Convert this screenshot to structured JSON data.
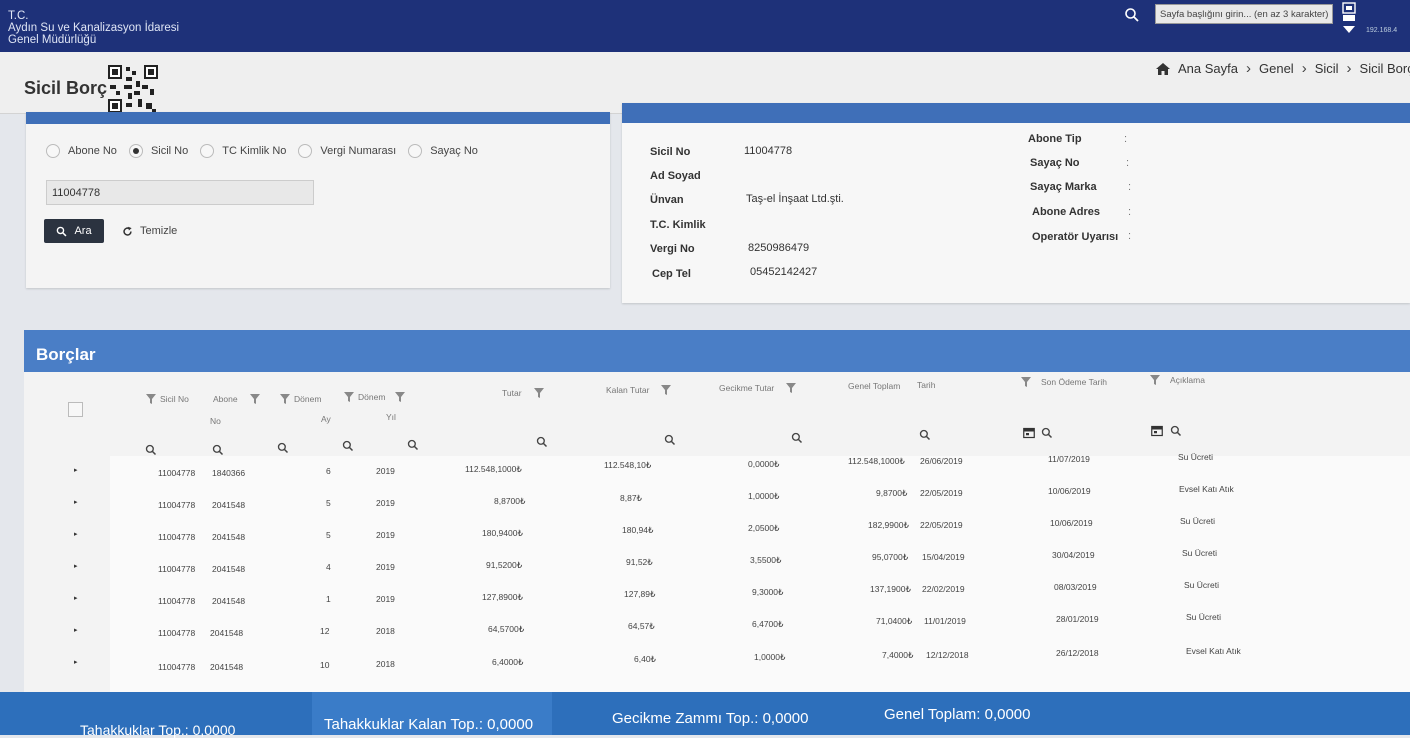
{
  "topbar": {
    "org_line1": "T.C.",
    "org_line2": "Aydın Su ve Kanalizasyon İdaresi",
    "org_line3": "Genel Müdürlüğü",
    "search_placeholder": "Sayfa başlığını girin... (en az 3 karakter)",
    "ip": "192.168.4"
  },
  "page": {
    "title": "Sicil Borç",
    "breadcrumb": [
      "Ana Sayfa",
      "Genel",
      "Sicil",
      "Sicil Borç"
    ]
  },
  "filter": {
    "options": [
      "Abone No",
      "Sicil No",
      "TC Kimlik No",
      "Vergi Numarası",
      "Sayaç No"
    ],
    "selected": "Sicil No",
    "value": "11004778",
    "search_button": "Ara",
    "clear_button": "Temizle"
  },
  "info": {
    "left": [
      {
        "label": "Sicil No",
        "value": "11004778"
      },
      {
        "label": "Ad Soyad",
        "value": ""
      },
      {
        "label": "Ünvan",
        "value": "Taş-el İnşaat Ltd.şti."
      },
      {
        "label": "T.C. Kimlik",
        "value": ""
      },
      {
        "label": "Vergi No",
        "value": "8250986479"
      },
      {
        "label": "Cep Tel",
        "value": "05452142427"
      }
    ],
    "right": [
      {
        "label": "Abone Tip",
        "value": ""
      },
      {
        "label": "Sayaç No",
        "value": ""
      },
      {
        "label": "Sayaç Marka",
        "value": ""
      },
      {
        "label": "Abone Adres",
        "value": ""
      },
      {
        "label": "Operatör Uyarısı",
        "value": ""
      }
    ]
  },
  "borclar": {
    "title": "Borçlar",
    "columns": {
      "sicil_no": "Sicil No",
      "abone_no_1": "Abone",
      "abone_no_2": "No",
      "donem_ay_1": "Dönem",
      "donem_ay_2": "Ay",
      "donem_yil_1": "Dönem",
      "donem_yil_2": "Yıl",
      "tutar": "Tutar",
      "kalan_tutar": "Kalan Tutar",
      "gecikme_tutar": "Gecikme Tutar",
      "genel_toplam": "Genel Toplam",
      "tarih": "Tarih",
      "son_odeme": "Son Ödeme Tarih",
      "aciklama": "Açıklama"
    },
    "rows": [
      {
        "sicil": "11004778",
        "abone": "1840366",
        "ay": "6",
        "yil": "2019",
        "tutar": "112.548,1000₺",
        "kalan": "112.548,10₺",
        "gecikme": "0,0000₺",
        "genel": "112.548,1000₺",
        "tarih": "26/06/2019",
        "son_odeme": "11/07/2019",
        "aciklama": "Su Ücreti"
      },
      {
        "sicil": "11004778",
        "abone": "2041548",
        "ay": "5",
        "yil": "2019",
        "tutar": "8,8700₺",
        "kalan": "8,87₺",
        "gecikme": "1,0000₺",
        "genel": "9,8700₺",
        "tarih": "22/05/2019",
        "son_odeme": "10/06/2019",
        "aciklama": "Evsel Katı Atık"
      },
      {
        "sicil": "11004778",
        "abone": "2041548",
        "ay": "5",
        "yil": "2019",
        "tutar": "180,9400₺",
        "kalan": "180,94₺",
        "gecikme": "2,0500₺",
        "genel": "182,9900₺",
        "tarih": "22/05/2019",
        "son_odeme": "10/06/2019",
        "aciklama": "Su Ücreti"
      },
      {
        "sicil": "11004778",
        "abone": "2041548",
        "ay": "4",
        "yil": "2019",
        "tutar": "91,5200₺",
        "kalan": "91,52₺",
        "gecikme": "3,5500₺",
        "genel": "95,0700₺",
        "tarih": "15/04/2019",
        "son_odeme": "30/04/2019",
        "aciklama": "Su Ücreti"
      },
      {
        "sicil": "11004778",
        "abone": "2041548",
        "ay": "1",
        "yil": "2019",
        "tutar": "127,8900₺",
        "kalan": "127,89₺",
        "gecikme": "9,3000₺",
        "genel": "137,1900₺",
        "tarih": "22/02/2019",
        "son_odeme": "08/03/2019",
        "aciklama": "Su Ücreti"
      },
      {
        "sicil": "11004778",
        "abone": "2041548",
        "ay": "12",
        "yil": "2018",
        "tutar": "64,5700₺",
        "kalan": "64,57₺",
        "gecikme": "6,4700₺",
        "genel": "71,0400₺",
        "tarih": "11/01/2019",
        "son_odeme": "28/01/2019",
        "aciklama": "Su Ücreti"
      },
      {
        "sicil": "11004778",
        "abone": "2041548",
        "ay": "10",
        "yil": "2018",
        "tutar": "6,4000₺",
        "kalan": "6,40₺",
        "gecikme": "1,0000₺",
        "genel": "7,4000₺",
        "tarih": "12/12/2018",
        "son_odeme": "26/12/2018",
        "aciklama": "Evsel Katı Atık"
      }
    ]
  },
  "footer": {
    "tahakkuk": "Tahakkuklar Top.: 0,0000",
    "kalan": "Tahakkuklar Kalan Top.: 0,0000",
    "gecikme": "Gecikme Zammı Top.: 0,0000",
    "genel": "Genel Toplam: 0,0000"
  },
  "colors": {
    "navy": "#1e3179",
    "blue": "#3f6fb8",
    "grid_header": "#4a7ec6",
    "footer": "#2d6fbb"
  }
}
